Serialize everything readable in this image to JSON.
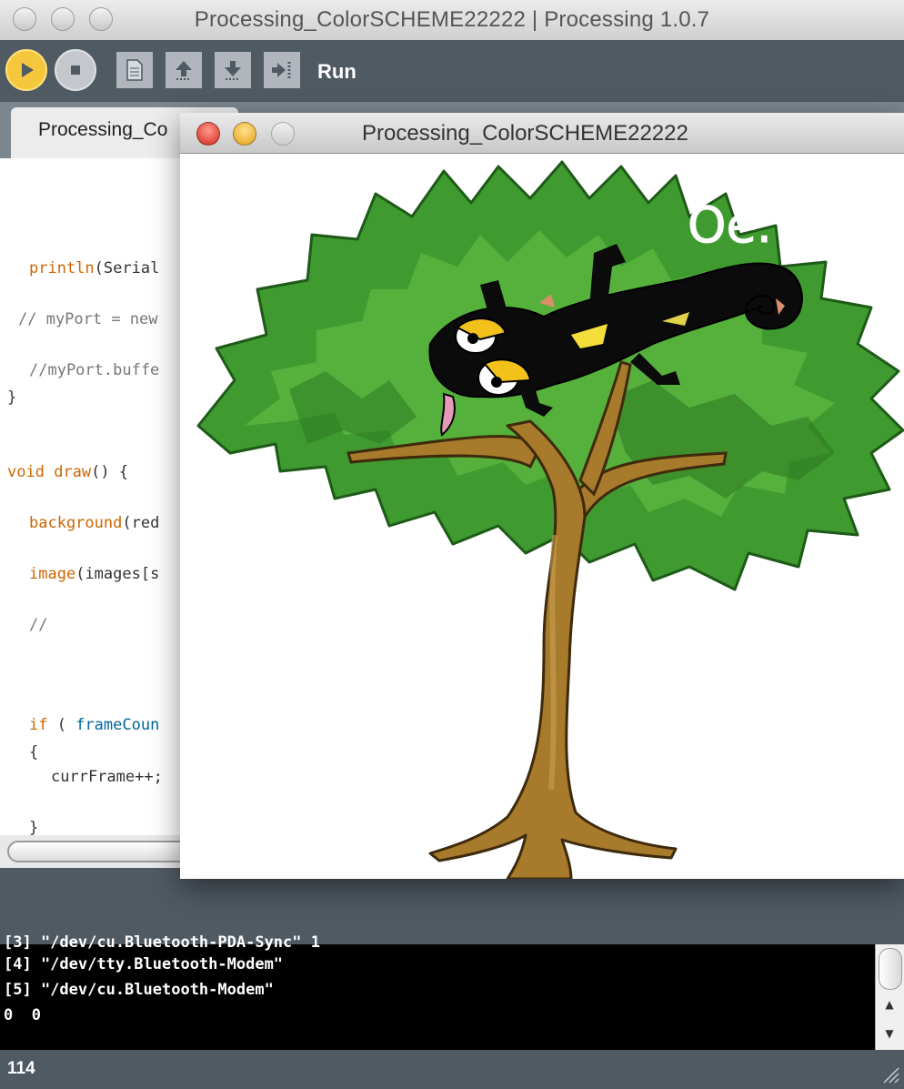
{
  "ide": {
    "title": "Processing_ColorSCHEME22222 | Processing 1.0.7",
    "toolbar": {
      "run_label": "Run",
      "icons": [
        "play-icon",
        "stop-icon",
        "new-icon",
        "open-icon",
        "save-icon",
        "export-icon"
      ]
    },
    "tab": {
      "label": "Processing_Co"
    },
    "code_lines": {
      "l1_fn": "println",
      "l1_rest": "(Serial",
      "l2": "// myPort = new",
      "l3": "//myPort.buffe",
      "l4": "}",
      "l5_kw": "void",
      "l5_fn": "draw",
      "l5_rest": "() {",
      "l6_fn": "background",
      "l6_rest": "(red",
      "l7_fn": "image",
      "l7_rest": "(images[s",
      "l8": "//",
      "l9_kw": "if",
      "l9_mid": " ( ",
      "l9_lit": "frameCoun",
      "l10": "{",
      "l11": "currFrame++;",
      "l12": "}"
    },
    "console": {
      "lines": [
        "[3] \"/dev/cu.Bluetooth-PDA-Sync\" 1",
        "[4] \"/dev/tty.Bluetooth-Modem\"",
        "[5] \"/dev/cu.Bluetooth-Modem\"",
        "0  0"
      ]
    },
    "status": {
      "line_number": "114"
    }
  },
  "sketch_window": {
    "title": "Processing_ColorSCHEME22222",
    "canvas_text": "Oe."
  },
  "colors": {
    "toolbar": "#505a63",
    "run_button": "#f5c73c",
    "code_keyword": "#cc6600",
    "code_literal": "#006699",
    "tree_green": "#3f9a2f",
    "tree_trunk": "#a77a2c"
  }
}
